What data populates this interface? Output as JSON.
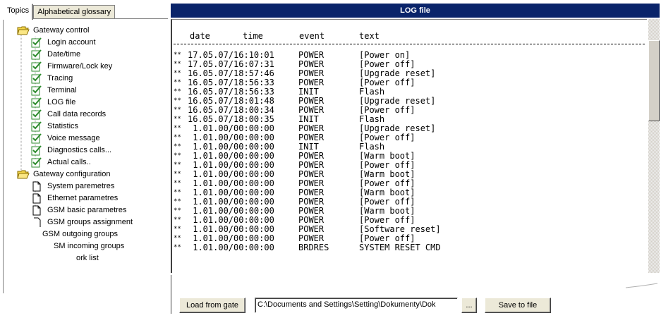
{
  "left_tabs": {
    "topics": "Topics",
    "glossary": "Alphabetical glossary"
  },
  "tree": {
    "gateway_control": "Gateway control",
    "control_items": [
      "Login account",
      "Date/time",
      "Firmware/Lock key",
      "Tracing",
      "Terminal",
      "LOG file",
      "Call data records",
      "Statistics",
      "Voice message",
      "Diagnostics calls...",
      "Actual calls.."
    ],
    "gateway_configuration": "Gateway configuration",
    "config_items": [
      "System paremetres",
      "Ethernet parametres",
      "GSM basic parametres",
      "GSM groups assignment",
      "GSM outgoing groups",
      "SM incoming groups",
      "ork list"
    ]
  },
  "log_window": {
    "title": "LOG file",
    "headers": {
      "date": "date",
      "time": "time",
      "event": "event",
      "text": "text"
    },
    "rows": [
      {
        "mark": "**",
        "datetime": "17.05.07/16:10:01",
        "event": "POWER",
        "text": "[Power on]"
      },
      {
        "mark": "**",
        "datetime": "17.05.07/16:07:31",
        "event": "POWER",
        "text": "[Power off]"
      },
      {
        "mark": "**",
        "datetime": "16.05.07/18:57:46",
        "event": "POWER",
        "text": "[Upgrade reset]"
      },
      {
        "mark": "**",
        "datetime": "16.05.07/18:56:33",
        "event": "POWER",
        "text": "[Power off]"
      },
      {
        "mark": "**",
        "datetime": "16.05.07/18:56:33",
        "event": "INIT",
        "text": "Flash"
      },
      {
        "mark": "**",
        "datetime": "16.05.07/18:01:48",
        "event": "POWER",
        "text": "[Upgrade reset]"
      },
      {
        "mark": "**",
        "datetime": "16.05.07/18:00:34",
        "event": "POWER",
        "text": "[Power off]"
      },
      {
        "mark": "**",
        "datetime": "16.05.07/18:00:35",
        "event": "INIT",
        "text": "Flash"
      },
      {
        "mark": "**",
        "datetime": " 1.01.00/00:00:00",
        "event": "POWER",
        "text": "[Upgrade reset]"
      },
      {
        "mark": "**",
        "datetime": " 1.01.00/00:00:00",
        "event": "POWER",
        "text": "[Power off]"
      },
      {
        "mark": "**",
        "datetime": " 1.01.00/00:00:00",
        "event": "INIT",
        "text": "Flash"
      },
      {
        "mark": "**",
        "datetime": " 1.01.00/00:00:00",
        "event": "POWER",
        "text": "[Warm boot]"
      },
      {
        "mark": "**",
        "datetime": " 1.01.00/00:00:00",
        "event": "POWER",
        "text": "[Power off]"
      },
      {
        "mark": "**",
        "datetime": " 1.01.00/00:00:00",
        "event": "POWER",
        "text": "[Warm boot]"
      },
      {
        "mark": "**",
        "datetime": " 1.01.00/00:00:00",
        "event": "POWER",
        "text": "[Power off]"
      },
      {
        "mark": "**",
        "datetime": " 1.01.00/00:00:00",
        "event": "POWER",
        "text": "[Warm boot]"
      },
      {
        "mark": "**",
        "datetime": " 1.01.00/00:00:00",
        "event": "POWER",
        "text": "[Power off]"
      },
      {
        "mark": "**",
        "datetime": " 1.01.00/00:00:00",
        "event": "POWER",
        "text": "[Warm boot]"
      },
      {
        "mark": "**",
        "datetime": " 1.01.00/00:00:00",
        "event": "POWER",
        "text": "[Power off]"
      },
      {
        "mark": "**",
        "datetime": " 1.01.00/00:00:00",
        "event": "POWER",
        "text": "[Software reset]"
      },
      {
        "mark": "**",
        "datetime": " 1.01.00/00:00:00",
        "event": "POWER",
        "text": "[Power off]"
      },
      {
        "mark": "**",
        "datetime": " 1.01.00/00:00:00",
        "event": "BRDRES",
        "text": "SYSTEM RESET CMD"
      }
    ]
  },
  "bottom": {
    "load_button": "Load from gate",
    "path_value": "C:\\Documents and Settings\\Setting\\Dokumenty\\Dok",
    "browse_button": "...",
    "save_button": "Save to file"
  },
  "colors": {
    "title_bar": "#0a246a",
    "window_face": "#ece9d8",
    "checkbox_green": "#2e8b2e",
    "folder_yellow": "#f3d54a"
  }
}
